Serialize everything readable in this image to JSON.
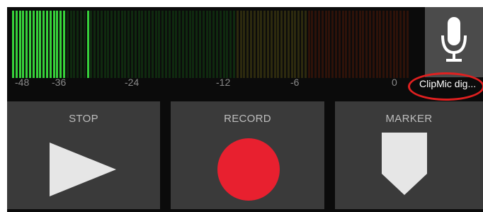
{
  "meter": {
    "ticks": [
      "-48",
      "-36",
      "-24",
      "-12",
      "-6",
      "0"
    ],
    "level_fraction": 0.13,
    "peak_fraction": 0.188,
    "colors": {
      "active": "#36d13a",
      "dim_green": "#0f2a0f",
      "dim_yellow": "#2d2a0e",
      "dim_red": "#2e1209"
    }
  },
  "input": {
    "device_label": "ClipMic dig...",
    "icon": "microphone-icon"
  },
  "controls": {
    "stop_label": "STOP",
    "record_label": "RECORD",
    "marker_label": "MARKER",
    "stop_icon": "play-triangle-icon",
    "record_icon": "record-dot-icon",
    "marker_icon": "marker-pin-icon"
  },
  "colors": {
    "record": "#e8202f",
    "panel": "#3a3a3a",
    "icon_light": "#e6e6e6",
    "callout": "#e02020"
  }
}
